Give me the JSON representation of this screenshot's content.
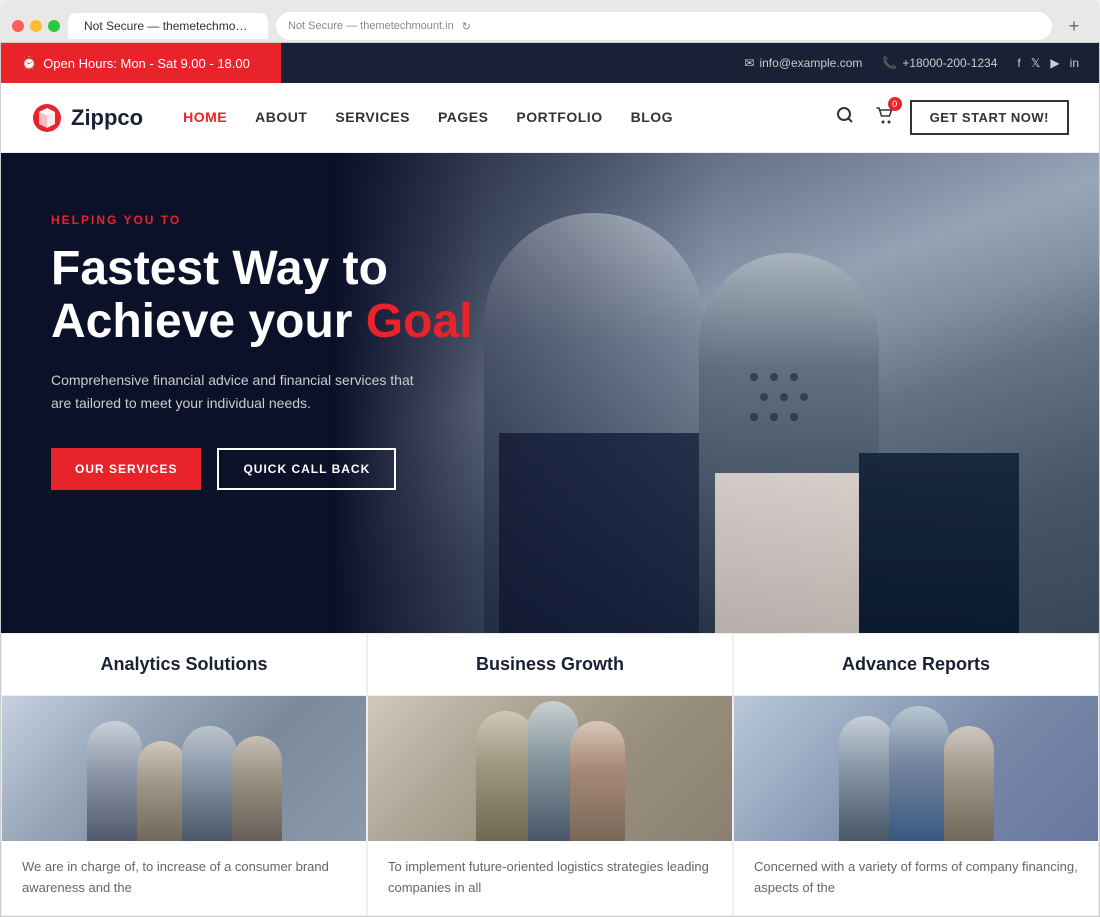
{
  "browser": {
    "tab_title": "Not Secure — themetechmount.in",
    "address": "Not Secure — themetechmount.in",
    "new_tab_icon": "+"
  },
  "topbar": {
    "left": {
      "icon": "⏰",
      "text": "Open Hours: Mon - Sat 9.00 - 18.00"
    },
    "right": {
      "email_icon": "✉",
      "email": "info@example.com",
      "phone_icon": "📞",
      "phone": "+18000-200-1234",
      "socials": [
        "f",
        "𝕏",
        "▶",
        "in"
      ]
    }
  },
  "navbar": {
    "logo_text": "Zippco",
    "links": [
      "HOME",
      "ABOUT",
      "SERVICES",
      "PAGES",
      "PORTFOLIO",
      "BLOG"
    ],
    "active_link": "HOME",
    "cart_count": "0",
    "cta_button": "GET START NOW!"
  },
  "hero": {
    "eyebrow": "HELPING YOU TO",
    "title_part1": "Fastest Way to",
    "title_part2": "Achieve your ",
    "title_highlight": "Goal",
    "description": "Comprehensive financial advice and financial services that are tailored to meet your individual needs.",
    "btn_primary": "OUR SERVICES",
    "btn_outline": "QUICK CALL BACK"
  },
  "features": [
    {
      "title": "Analytics Solutions",
      "description": "We are in charge of, to increase of a consumer brand awareness and the"
    },
    {
      "title": "Business Growth",
      "description": "To implement future-oriented logistics strategies leading companies in all"
    },
    {
      "title": "Advance Reports",
      "description": "Concerned with a variety of forms of company financing, aspects of the"
    }
  ]
}
